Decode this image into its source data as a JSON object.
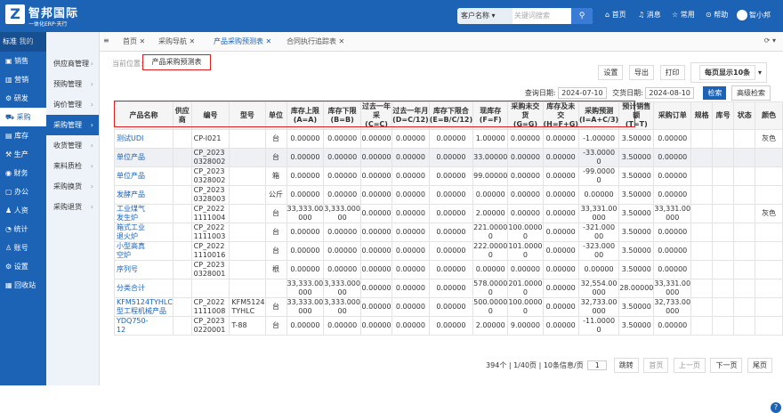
{
  "app": {
    "logo_char": "Z",
    "name": "智邦国际",
    "sub": "一体化ERP·天行"
  },
  "topbar": {
    "search_select": "客户名称",
    "search_placeholder": "关键词搜索",
    "nav": [
      "首页",
      "消息",
      "常用",
      "帮助"
    ],
    "user": "智小邦"
  },
  "sidebar": {
    "head": [
      "标准",
      "我的",
      "搜索"
    ],
    "items": [
      "销售",
      "营销",
      "研发",
      "采购",
      "库存",
      "生产",
      "财务",
      "办公",
      "人资",
      "统计",
      "账号",
      "设置",
      "回收站"
    ],
    "active_index": 3
  },
  "subnav": {
    "items": [
      "供应商管理",
      "预购管理",
      "询价管理",
      "采购管理",
      "收货管理",
      "来料质检",
      "采购换货",
      "采购退货"
    ],
    "active_index": 3
  },
  "tabs": {
    "items": [
      "首页",
      "采购导航",
      "产品采购预测表",
      "合同执行追踪表"
    ],
    "active_index": 2
  },
  "crumb": {
    "label": "当前位置:",
    "current": "产品采购预测表"
  },
  "tools": {
    "items": [
      "设置",
      "导出",
      "打印",
      "每页显示10条"
    ]
  },
  "filter": {
    "query_label": "查询日期:",
    "query_value": "2024-07-10",
    "delivery_label": "交货日期:",
    "delivery_value": "2024-08-10",
    "search": "检索",
    "advanced": "高级检索"
  },
  "table": {
    "headers": [
      "产品名称",
      "供应商",
      "编号",
      "型号",
      "单位",
      "库存上限\n(A=A)",
      "库存下限\n(B=B)",
      "过去一年采\n(C=C)",
      "过去一年月\n(D=C/12)",
      "库存下限合\n(E=B/C/12)",
      "现库存\n(F=F)",
      "采购未交货\n(G=G)",
      "库存及未交\n(H=F+G)",
      "采购预测\n(I=A+C/3)",
      "预计销售额\n(T=T)",
      "采购订单",
      "规格",
      "库号",
      "状态",
      "颜色"
    ],
    "rows": [
      [
        "测试UDI",
        "",
        "CP-I021",
        "",
        "台",
        "0.00000",
        "0.00000",
        "0.00000",
        "0.00000",
        "0.00000",
        "1.00000",
        "0.00000",
        "0.00000",
        "-1.00000",
        "3.50000",
        "0.00000",
        "",
        "",
        "",
        "灰色"
      ],
      [
        "单位产品",
        "",
        "CP_2023\n0328002",
        "",
        "台",
        "0.00000",
        "0.00000",
        "0.00000",
        "0.00000",
        "0.00000",
        "33.00000",
        "0.00000",
        "0.00000",
        "-33.0000\n0",
        "3.50000",
        "0.00000",
        "",
        "",
        "",
        ""
      ],
      [
        "单位产品",
        "",
        "CP_2023\n0328002",
        "",
        "箱",
        "0.00000",
        "0.00000",
        "0.00000",
        "0.00000",
        "0.00000",
        "99.00000",
        "0.00000",
        "0.00000",
        "-99.0000\n0",
        "3.50000",
        "0.00000",
        "",
        "",
        "",
        ""
      ],
      [
        "发酵产品",
        "",
        "CP_2023\n0328003",
        "",
        "公斤",
        "0.00000",
        "0.00000",
        "0.00000",
        "0.00000",
        "0.00000",
        "0.00000",
        "0.00000",
        "0.00000",
        "0.00000",
        "3.50000",
        "0.00000",
        "",
        "",
        "",
        ""
      ],
      [
        "工业煤气\n发生炉",
        "",
        "CP_2022\n1111004",
        "",
        "台",
        "33,333.00\n000",
        "3,333.000\n00",
        "0.00000",
        "0.00000",
        "0.00000",
        "2.00000",
        "0.00000",
        "0.00000",
        "33,331.00\n000",
        "3.50000",
        "33,331.00\n000",
        "",
        "",
        "",
        "灰色"
      ],
      [
        "箱式工业\n退火炉",
        "",
        "CP_2022\n1111003",
        "",
        "台",
        "0.00000",
        "0.00000",
        "0.00000",
        "0.00000",
        "0.00000",
        "221.0000\n0",
        "100.0000\n0",
        "0.00000",
        "-321.000\n00",
        "3.50000",
        "0.00000",
        "",
        "",
        "",
        ""
      ],
      [
        "小型高真\n空炉",
        "",
        "CP_2022\n1110016",
        "",
        "台",
        "0.00000",
        "0.00000",
        "0.00000",
        "0.00000",
        "0.00000",
        "222.0000\n0",
        "101.0000\n0",
        "0.00000",
        "-323.000\n00",
        "3.50000",
        "0.00000",
        "",
        "",
        "",
        ""
      ],
      [
        "序列号",
        "",
        "CP_2023\n0328001",
        "",
        "根",
        "0.00000",
        "0.00000",
        "0.00000",
        "0.00000",
        "0.00000",
        "0.00000",
        "0.00000",
        "0.00000",
        "0.00000",
        "3.50000",
        "0.00000",
        "",
        "",
        "",
        ""
      ],
      [
        "分类合计",
        "",
        "",
        "",
        "",
        "33,333.00\n000",
        "3,333.000\n00",
        "0.00000",
        "0.00000",
        "0.00000",
        "578.0000\n0",
        "201.0000\n0",
        "0.00000",
        "32,554.00\n000",
        "28.00000",
        "33,331.00\n000",
        "",
        "",
        "",
        ""
      ],
      [
        "KFM5124TYHLC\n型工程机械产品",
        "",
        "CP_2022\n1111008",
        "KFM5124\nTYHLC",
        "台",
        "33,333.00\n000",
        "3,333.000\n00",
        "0.00000",
        "0.00000",
        "0.00000",
        "500.0000\n0",
        "100.0000\n0",
        "0.00000",
        "32,733.00\n000",
        "3.50000",
        "32,733.00\n000",
        "",
        "",
        "",
        ""
      ],
      [
        "YDQ750-\n12",
        "",
        "CP_2023\n0220001",
        "T-88",
        "台",
        "0.00000",
        "0.00000",
        "0.00000",
        "0.00000",
        "0.00000",
        "2.00000",
        "9.00000",
        "0.00000",
        "-11.0000\n0",
        "3.50000",
        "0.00000",
        "",
        "",
        "",
        ""
      ]
    ],
    "highlight_row": 1
  },
  "pager": {
    "summary": "394个 | 1/40页 | 10条信息/页",
    "page": "1",
    "go": "跳转",
    "first": "首页",
    "prev": "上一页",
    "next": "下一页",
    "last": "尾页"
  },
  "help": "?"
}
